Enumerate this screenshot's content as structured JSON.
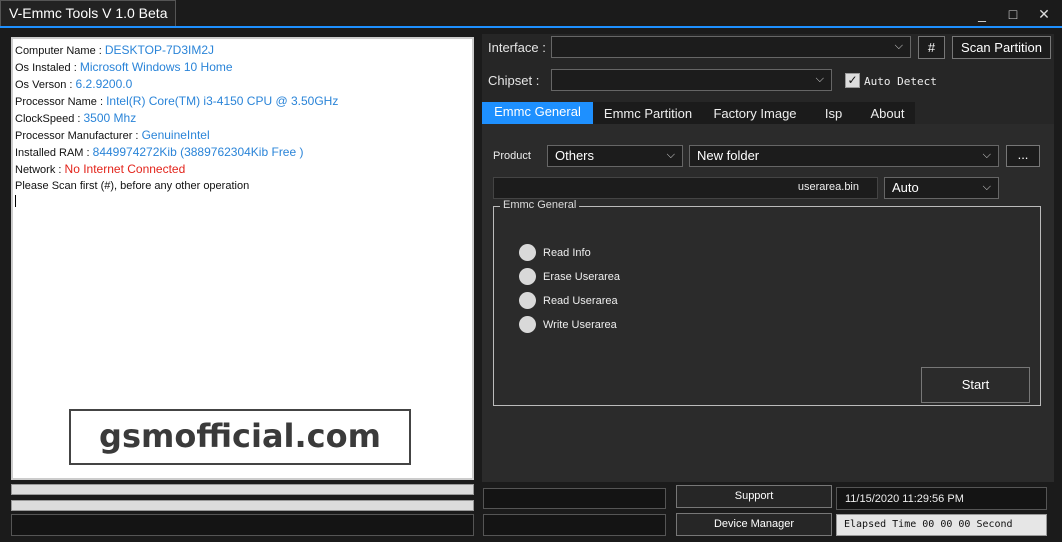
{
  "window": {
    "title": "V-Emmc Tools V 1.0 Beta",
    "minimize": "_",
    "maximize": "□",
    "close": "✕"
  },
  "log": {
    "lines": [
      {
        "label": "Computer Name :",
        "value": "DESKTOP-7D3IM2J"
      },
      {
        "label": "Os Instaled :",
        "value": "Microsoft Windows 10 Home"
      },
      {
        "label": "Os Verson :",
        "value": "6.2.9200.0"
      },
      {
        "label": "Processor Name :",
        "value": "Intel(R) Core(TM) i3-4150 CPU @ 3.50GHz"
      },
      {
        "label": "ClockSpeed :",
        "value": "3500 Mhz"
      },
      {
        "label": "Processor Manufacturer :",
        "value": "GenuineIntel"
      },
      {
        "label": "Installed RAM :",
        "value": "8449974272Kib (3889762304Kib Free )"
      },
      {
        "label": "Network :",
        "value": "No Internet Connected"
      },
      {
        "label": "Please Scan first (#), before any other operation",
        "value": ""
      }
    ],
    "watermark": "gsmofficial.com"
  },
  "interface": {
    "label": "Interface :",
    "value": "",
    "hash_button": "#",
    "scan_button": "Scan Partition"
  },
  "chipset": {
    "label": "Chipset :",
    "value": "",
    "auto_detect_label": "Auto Detect",
    "auto_detect_checked": true
  },
  "tabs": [
    "Emmc General",
    "Emmc Partition",
    "Factory Image",
    "Isp",
    "About"
  ],
  "active_tab": "Emmc General",
  "product": {
    "label": "Product",
    "value": "Others",
    "folder": "New folder",
    "browse": "..."
  },
  "file": {
    "name": "userarea.bin",
    "mode": "Auto"
  },
  "group": {
    "title": "Emmc General",
    "options": [
      "Read Info",
      "Erase Userarea",
      "Read Userarea",
      "Write Userarea"
    ],
    "start": "Start"
  },
  "footer": {
    "support": "Support",
    "device_manager": "Device Manager",
    "datetime": "11/15/2020 11:29:56 PM",
    "elapsed": "Elapsed Time 00 00 00 Second"
  }
}
